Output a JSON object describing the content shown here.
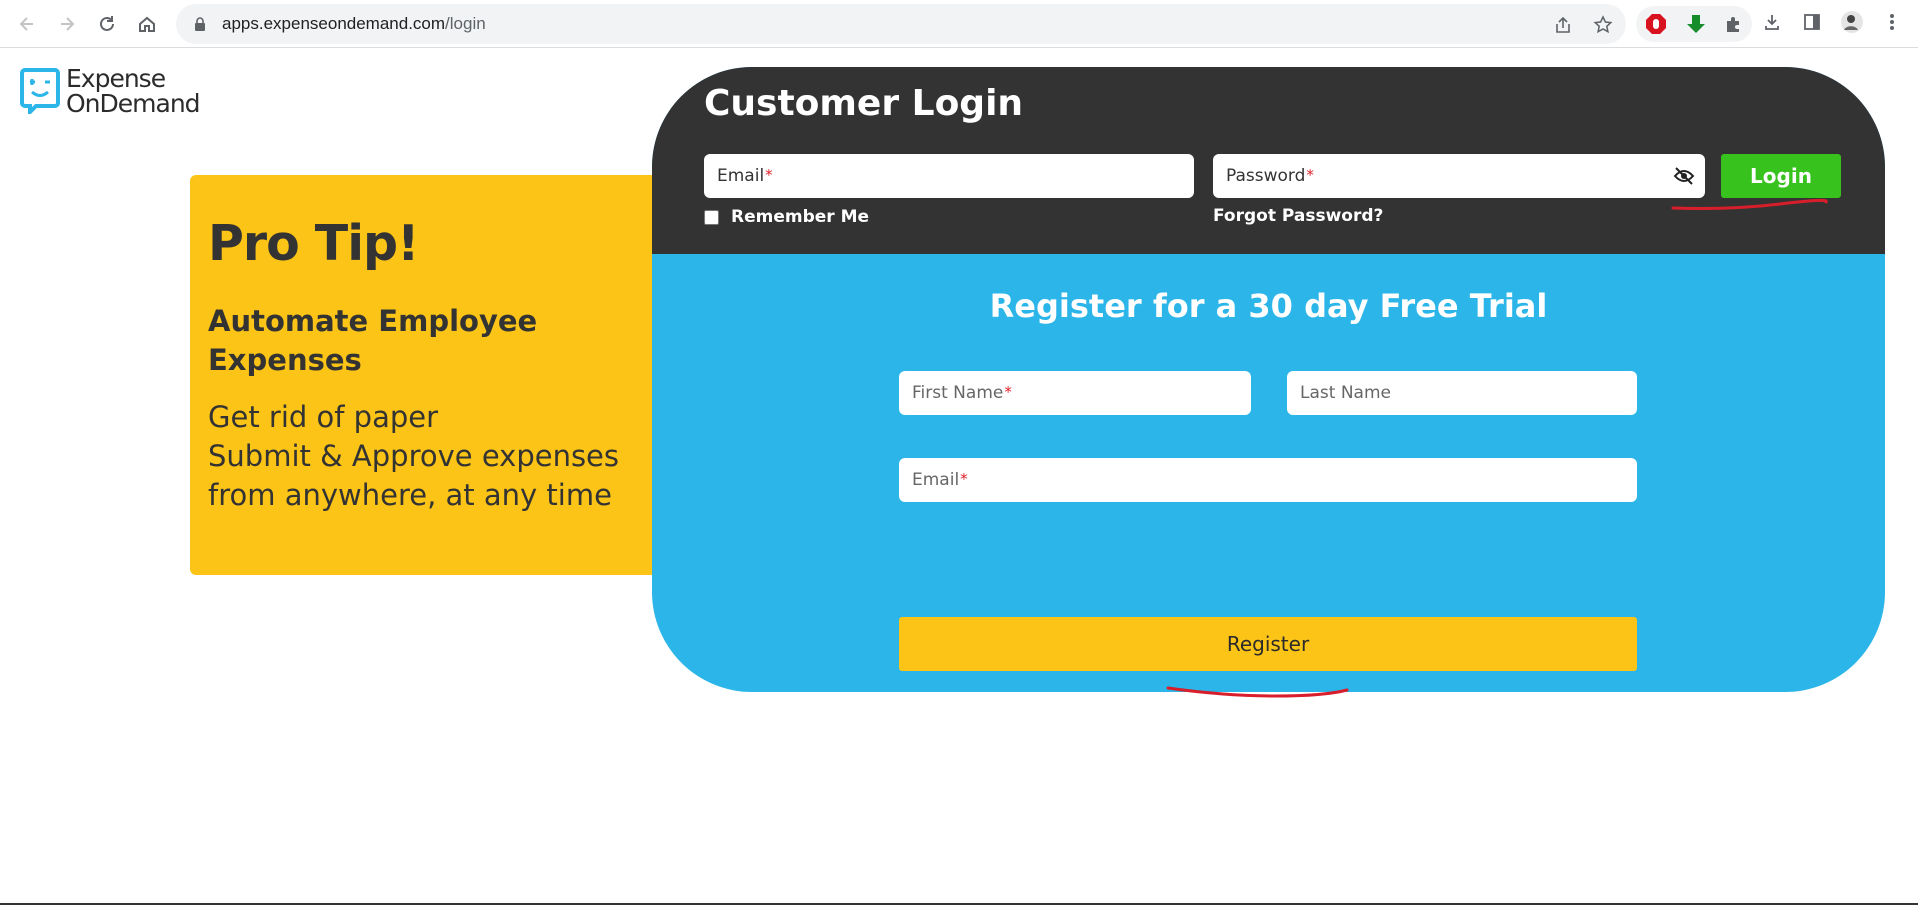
{
  "browser": {
    "url_host": "apps.expenseondemand.com",
    "url_path": "/login",
    "icons": [
      "back-icon",
      "forward-icon",
      "reload-icon",
      "home-icon",
      "lock-icon",
      "share-icon",
      "bookmark-star-icon",
      "adblock-icon",
      "download-arrow-icon",
      "extensions-icon",
      "downloads-icon",
      "side-panel-icon",
      "profile-avatar",
      "menu-icon"
    ]
  },
  "logo": {
    "line1": "Expense",
    "line2": "OnDemand"
  },
  "protip": {
    "title": "Pro Tip!",
    "subtitle": "Automate Employee Expenses",
    "line1": "Get rid of paper",
    "line2": "Submit & Approve expenses",
    "line3": "from anywhere, at any time"
  },
  "login": {
    "title": "Customer Login",
    "email_placeholder": "Email",
    "password_placeholder": "Password",
    "required_mark": "*",
    "login_button": "Login",
    "remember_me": "Remember Me",
    "forgot_password": "Forgot Password?"
  },
  "register": {
    "title": "Register for a 30 day Free Trial",
    "first_name_placeholder": "First Name",
    "last_name_placeholder": "Last Name",
    "email_placeholder": "Email",
    "required_mark": "*",
    "register_button": "Register"
  },
  "colors": {
    "dark": "#333333",
    "blue": "#2bb5e8",
    "yellow": "#fbc416",
    "green": "#37c21d",
    "annotation_red": "#d81e2b"
  }
}
